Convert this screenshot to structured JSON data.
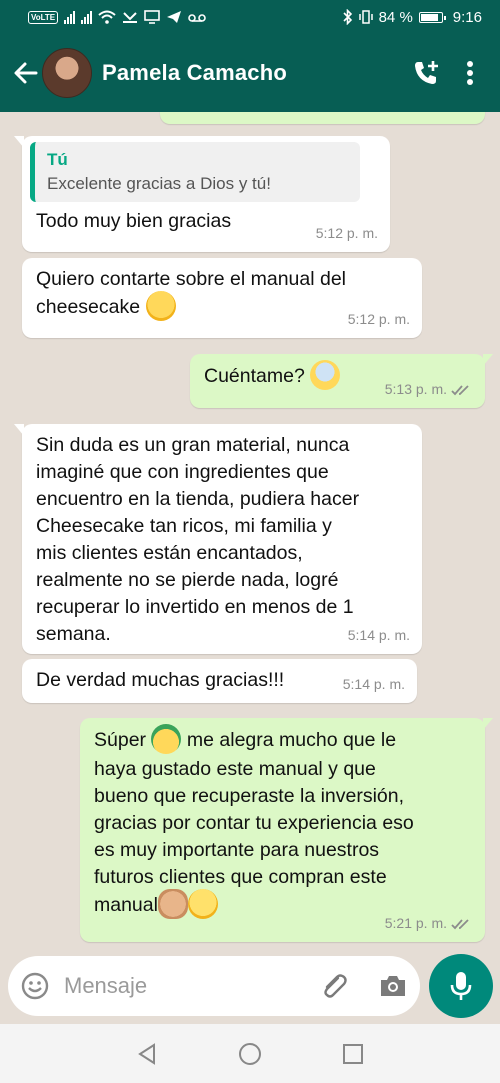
{
  "status_bar": {
    "volte": "VoLTE",
    "battery_percent": "84 %",
    "time": "9:16"
  },
  "header": {
    "contact_name": "Pamela Camacho"
  },
  "messages": [
    {
      "direction": "in",
      "quote_author": "Tú",
      "quote_text": "Excelente gracias a Dios y tú!",
      "text": "Todo muy bien gracias",
      "time": "5:12 p. m."
    },
    {
      "direction": "in",
      "text_line1": "Quiero contarte sobre el manual del",
      "text_line2": "cheesecake",
      "emoji": "hand-over-mouth-emoji",
      "time": "5:12 p. m."
    },
    {
      "direction": "out",
      "text": "Cuéntame?",
      "emoji": "screaming-face-emoji",
      "time": "5:13 p. m.",
      "status": "read"
    },
    {
      "direction": "in",
      "lines": [
        "Sin duda es un gran material, nunca",
        "imaginé que con ingredientes que",
        "encuentro en la tienda, pudiera hacer",
        "Cheesecake tan ricos, mi familia y",
        "mis clientes están encantados,",
        "realmente no se pierde nada, logré",
        "recuperar lo invertido en menos de 1",
        "semana."
      ],
      "time": "5:14 p. m."
    },
    {
      "direction": "in",
      "text": "De verdad muchas gracias!!!",
      "time": "5:14 p. m."
    },
    {
      "direction": "out",
      "line1_a": "Súper",
      "line1_b": "me alegra mucho que le",
      "lines": [
        "haya gustado este manual y que",
        "bueno que recuperaste la inversión,",
        "gracias por contar tu experiencia eso",
        "es muy importante para nuestros",
        "futuros clientes que compran este"
      ],
      "last_line": "manual",
      "time": "5:21 p. m.",
      "status": "read"
    }
  ],
  "composer": {
    "placeholder": "Mensaje"
  },
  "colors": {
    "header": "#075e54",
    "incoming_bubble": "#ffffff",
    "outgoing_bubble": "#dcf8c6",
    "accent": "#00897b",
    "read_ticks": "#8c8c8c"
  }
}
